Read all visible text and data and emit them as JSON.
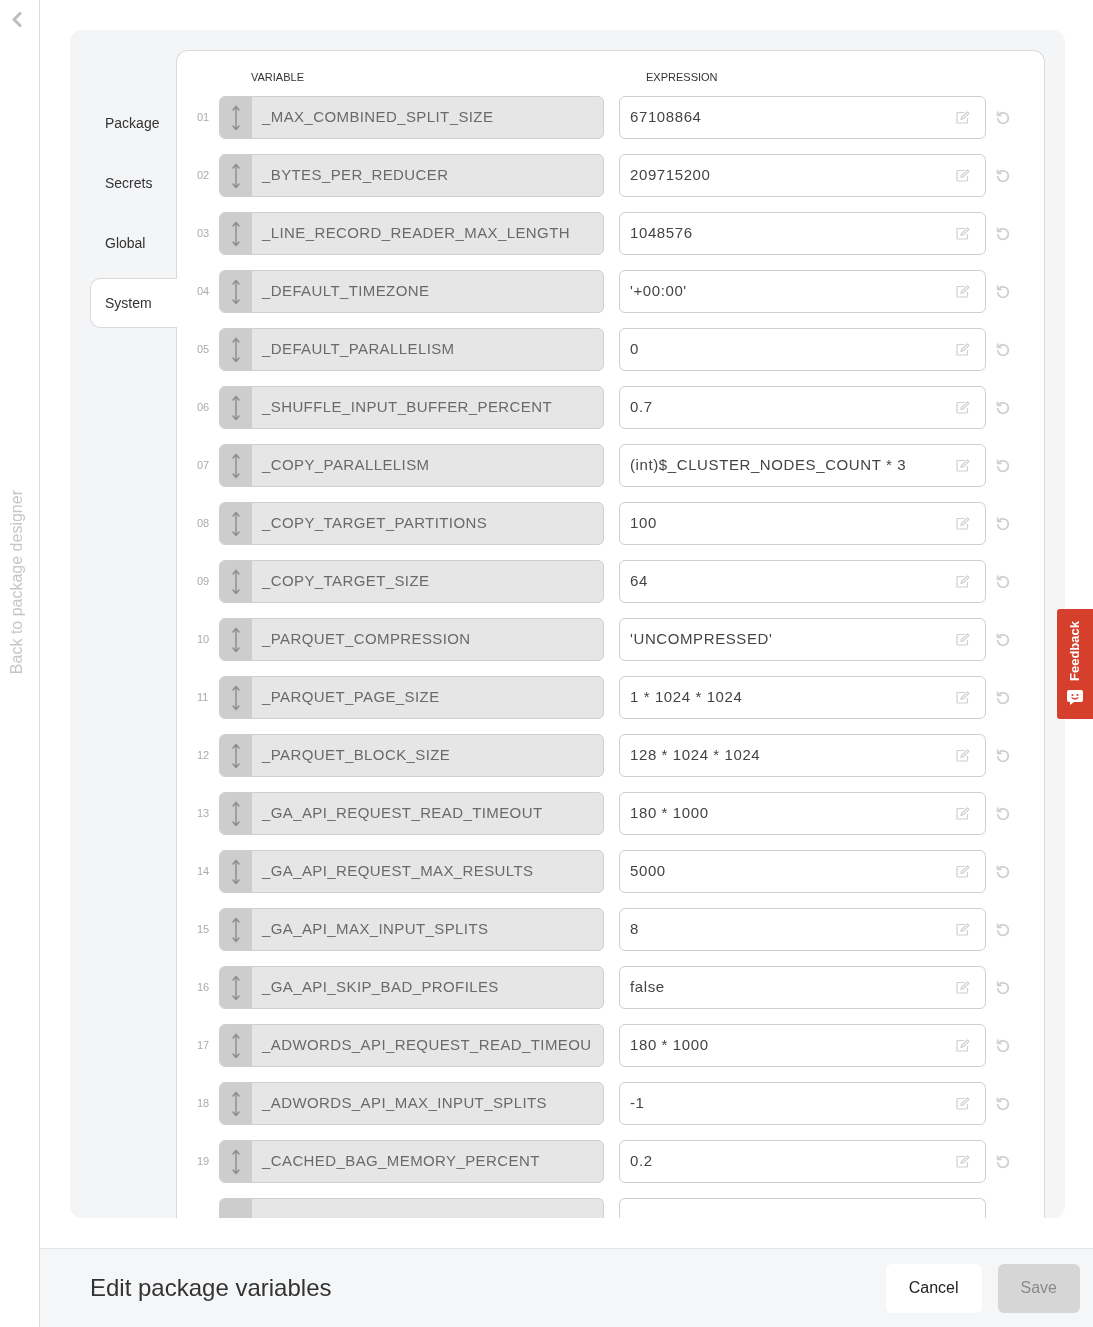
{
  "sidebar": {
    "back_label": "Back to package designer"
  },
  "tabs": [
    {
      "label": "Package",
      "selected": false
    },
    {
      "label": "Secrets",
      "selected": false
    },
    {
      "label": "Global",
      "selected": false
    },
    {
      "label": "System",
      "selected": true
    }
  ],
  "table": {
    "columns": [
      "VARIABLE",
      "EXPRESSION"
    ],
    "rows": [
      {
        "kind": "full",
        "number": "01",
        "variable": "_MAX_COMBINED_SPLIT_SIZE",
        "expression": "67108864"
      },
      {
        "kind": "full",
        "number": "02",
        "variable": "_BYTES_PER_REDUCER",
        "expression": "209715200"
      },
      {
        "kind": "full",
        "number": "03",
        "variable": "_LINE_RECORD_READER_MAX_LENGTH",
        "expression": "1048576"
      },
      {
        "kind": "full",
        "number": "04",
        "variable": "_DEFAULT_TIMEZONE",
        "expression": "'+00:00'"
      },
      {
        "kind": "full",
        "number": "05",
        "variable": "_DEFAULT_PARALLELISM",
        "expression": "0"
      },
      {
        "kind": "full",
        "number": "06",
        "variable": "_SHUFFLE_INPUT_BUFFER_PERCENT",
        "expression": "0.7"
      },
      {
        "kind": "full",
        "number": "07",
        "variable": "_COPY_PARALLELISM",
        "expression": "(int)$_CLUSTER_NODES_COUNT * 3"
      },
      {
        "kind": "full",
        "number": "08",
        "variable": "_COPY_TARGET_PARTITIONS",
        "expression": "100"
      },
      {
        "kind": "full",
        "number": "09",
        "variable": "_COPY_TARGET_SIZE",
        "expression": "64"
      },
      {
        "kind": "full",
        "number": "10",
        "variable": "_PARQUET_COMPRESSION",
        "expression": "'UNCOMPRESSED'"
      },
      {
        "kind": "full",
        "number": "11",
        "variable": "_PARQUET_PAGE_SIZE",
        "expression": "1 * 1024 * 1024"
      },
      {
        "kind": "full",
        "number": "12",
        "variable": "_PARQUET_BLOCK_SIZE",
        "expression": "128 * 1024 * 1024"
      },
      {
        "kind": "full",
        "number": "13",
        "variable": "_GA_API_REQUEST_READ_TIMEOUT",
        "expression": "180 * 1000"
      },
      {
        "kind": "full",
        "number": "14",
        "variable": "_GA_API_REQUEST_MAX_RESULTS",
        "expression": "5000"
      },
      {
        "kind": "full",
        "number": "15",
        "variable": "_GA_API_MAX_INPUT_SPLITS",
        "expression": "8"
      },
      {
        "kind": "full",
        "number": "16",
        "variable": "_GA_API_SKIP_BAD_PROFILES",
        "expression": "false"
      },
      {
        "kind": "full",
        "number": "17",
        "variable": "_ADWORDS_API_REQUEST_READ_TIMEOU",
        "expression": "180 * 1000"
      },
      {
        "kind": "full",
        "number": "18",
        "variable": "_ADWORDS_API_MAX_INPUT_SPLITS",
        "expression": "-1"
      },
      {
        "kind": "full",
        "number": "19",
        "variable": "_CACHED_BAG_MEMORY_PERCENT",
        "expression": "0.2"
      },
      {
        "kind": "clipped"
      }
    ]
  },
  "footer": {
    "title": "Edit package variables",
    "buttons": [
      {
        "label": "Cancel",
        "kind": "secondary",
        "disabled": false
      },
      {
        "label": "Save",
        "kind": "primary",
        "disabled": true
      }
    ]
  },
  "feedback_tab": {
    "label": "Feedback"
  }
}
